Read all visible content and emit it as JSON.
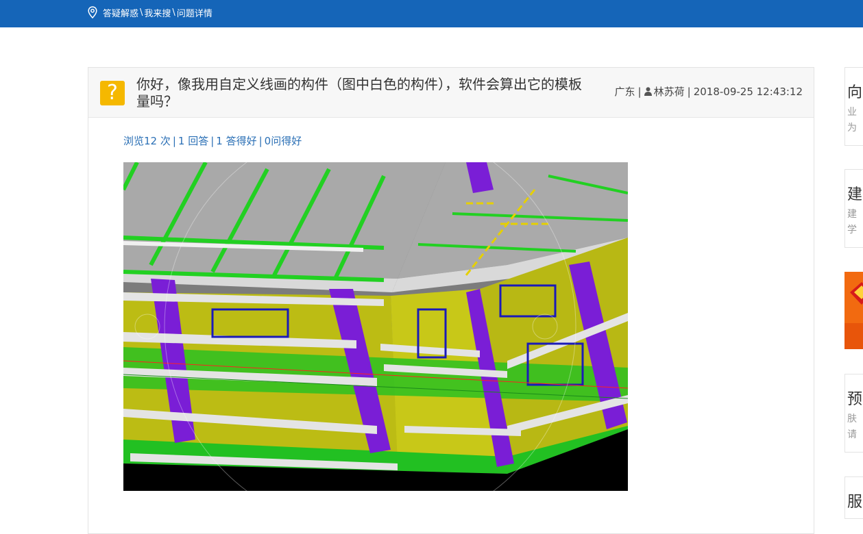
{
  "breadcrumb": {
    "items": [
      "答疑解惑",
      "我来搜",
      "问题详情"
    ],
    "separator": "\\"
  },
  "question": {
    "icon": "question-mark-icon",
    "icon_glyph": "?",
    "title": "你好，像我用自定义线画的构件（图中白色的构件），软件会算出它的模板量吗？",
    "region": "广东",
    "author": "林苏荷",
    "datetime": "2018-09-25 12:43:12"
  },
  "stats": {
    "views": "浏览12 次",
    "answers": "1 回答",
    "good_answers": "1 答得好",
    "good_questions": "0问得好"
  },
  "sidebar": {
    "cards": [
      {
        "heading": "向",
        "line1": "业",
        "line2": "为"
      },
      {
        "heading": "建",
        "line1": "建",
        "line2": "学"
      },
      {
        "heading": "预",
        "line1": "肤",
        "line2": "请"
      },
      {
        "heading": "服"
      }
    ]
  },
  "colors": {
    "topbar": "#1565b8",
    "link": "#2a6fb5",
    "question_icon": "#f5b800",
    "ad": "#f26a10"
  }
}
